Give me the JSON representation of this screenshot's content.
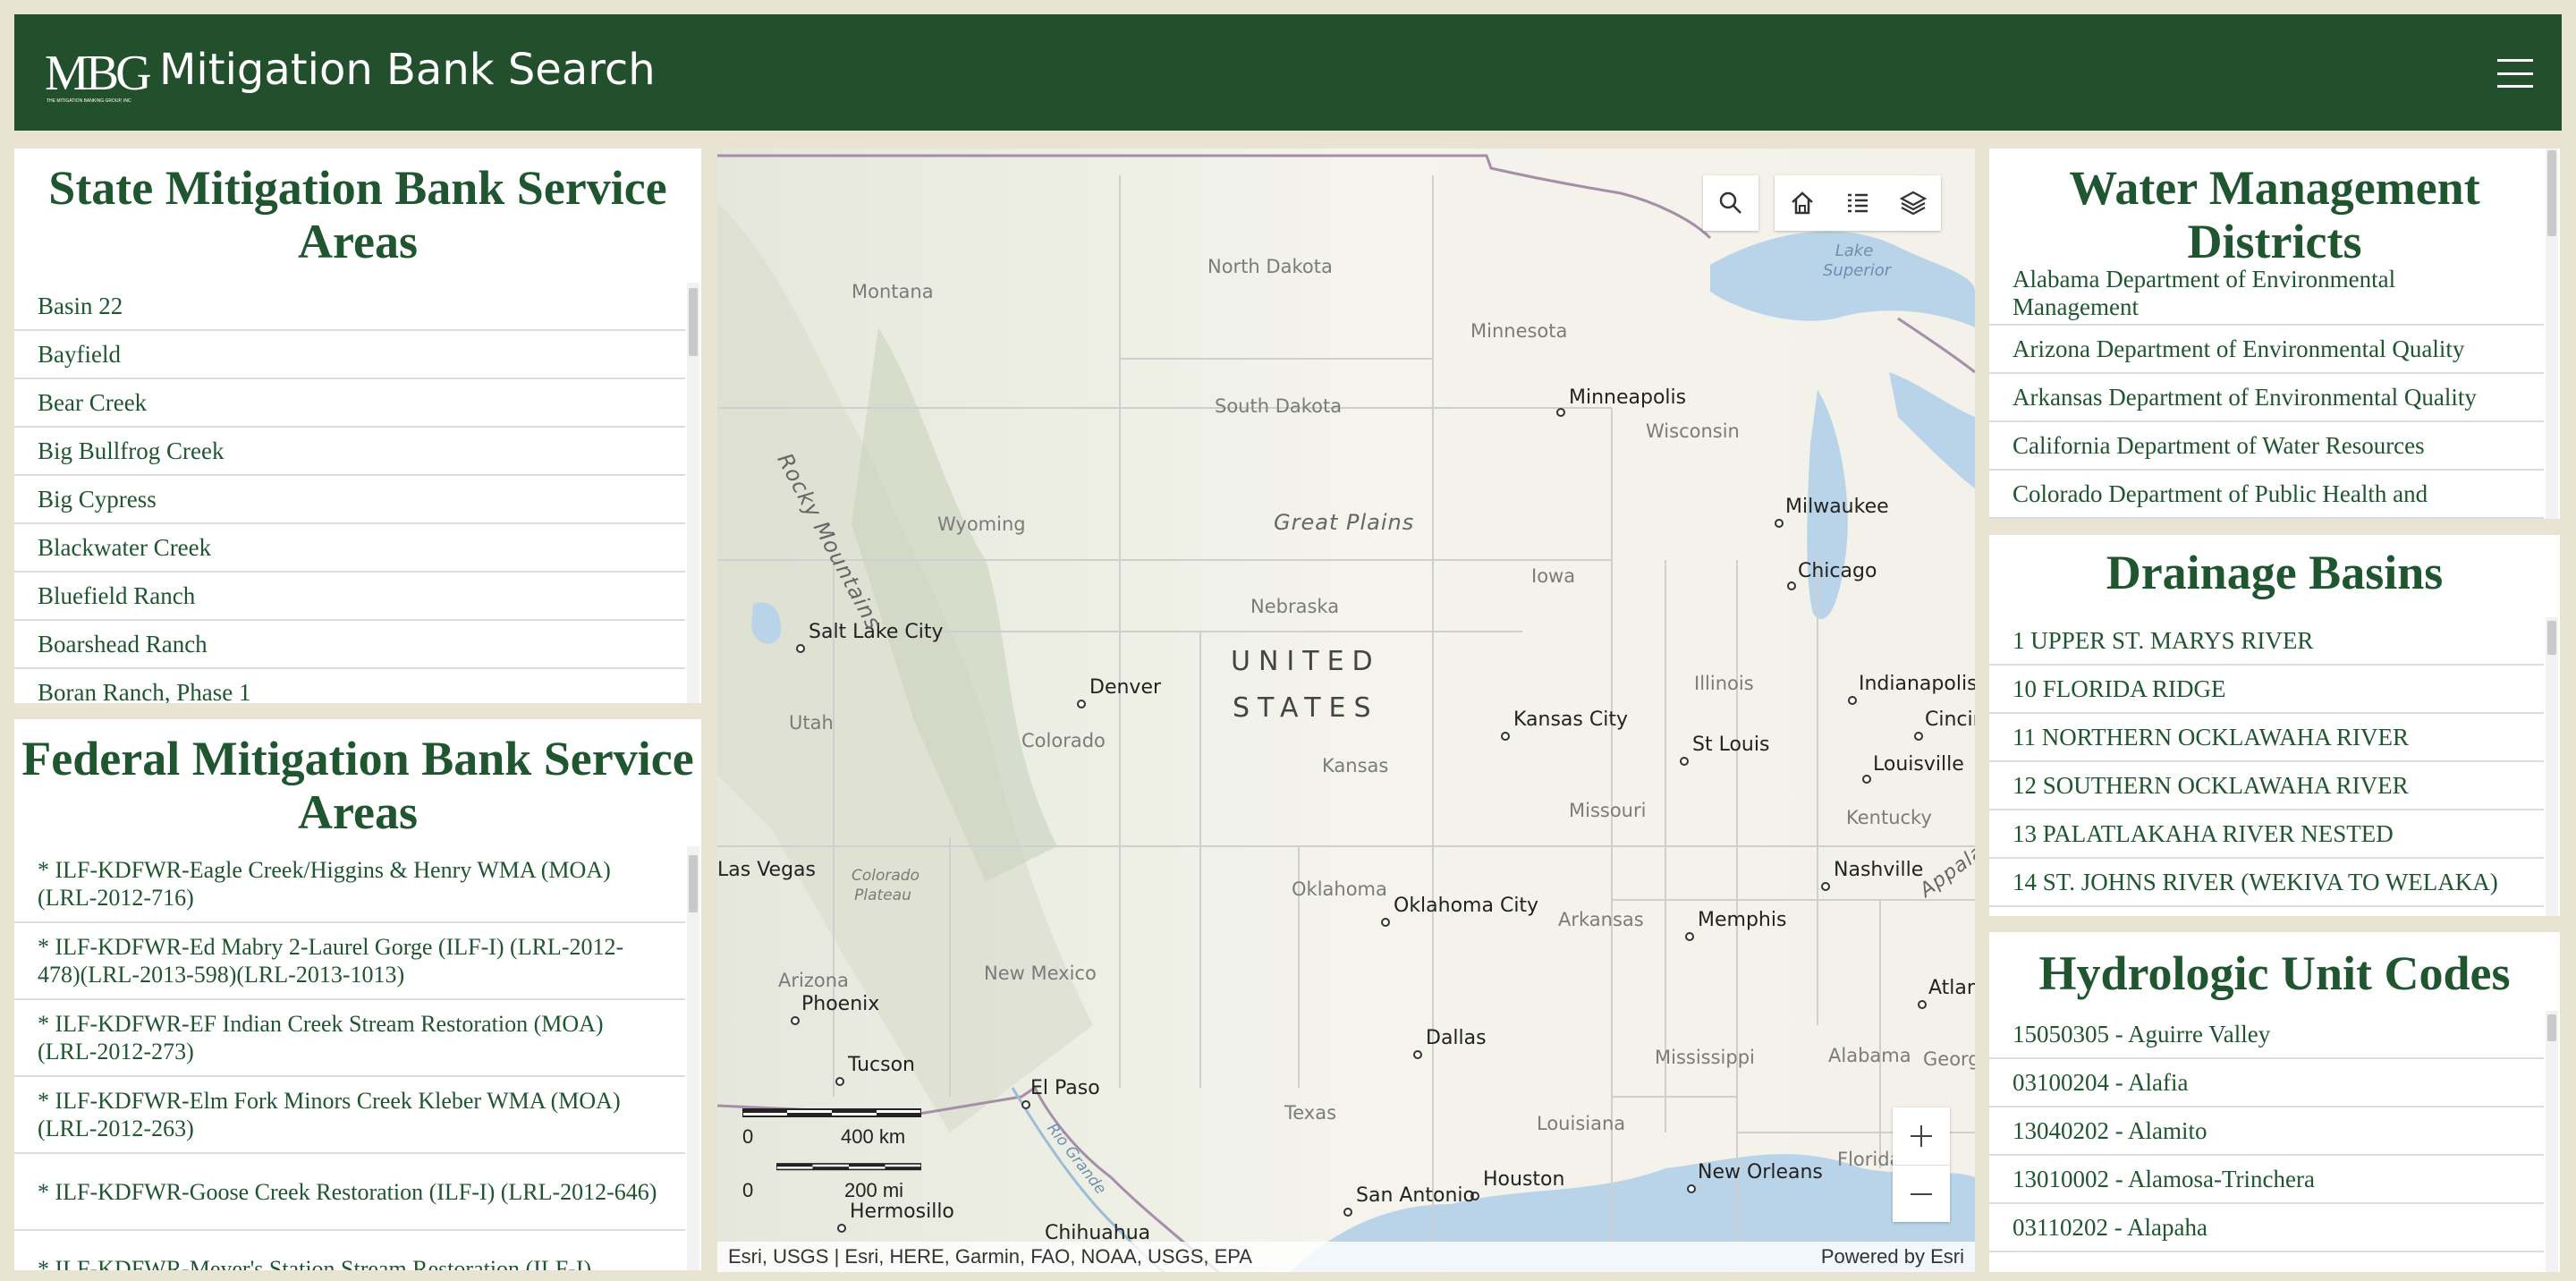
{
  "header": {
    "logo_text": "MBG",
    "logo_subtext": "THE MITIGATION BANKING GROUP, INC",
    "title": "Mitigation Bank Search",
    "menu_icon": "hamburger-menu-icon"
  },
  "state_panel": {
    "title": "State Mitigation Bank Service Areas",
    "items": [
      "Basin 22",
      "Bayfield",
      "Bear Creek",
      "Big Bullfrog Creek",
      "Big Cypress",
      "Blackwater Creek",
      "Bluefield Ranch",
      "Boarshead Ranch",
      "Boran Ranch, Phase 1"
    ]
  },
  "federal_panel": {
    "title": "Federal Mitigation Bank Service Areas",
    "items": [
      "* ILF-KDFWR-Eagle Creek/Higgins & Henry WMA (MOA) (LRL-2012-716)",
      "* ILF-KDFWR-Ed Mabry 2-Laurel Gorge (ILF-I) (LRL-2012-478)(LRL-2013-598)(LRL-2013-1013)",
      "* ILF-KDFWR-EF Indian Creek Stream Restoration (MOA) (LRL-2012-273)",
      "* ILF-KDFWR-Elm Fork Minors Creek Kleber WMA (MOA) (LRL-2012-263)",
      "* ILF-KDFWR-Goose Creek Restoration (ILF-I) (LRL-2012-646)",
      "* ILF-KDFWR-Meyer's Station Stream Restoration (ILF-I)"
    ]
  },
  "water_panel": {
    "title": "Water Management Districts",
    "items": [
      "Alabama Department of Environmental Management",
      "Arizona Department of Environmental Quality",
      "Arkansas Department of Environmental Quality",
      "California Department of Water Resources",
      "Colorado Department of Public Health and"
    ]
  },
  "drainage_panel": {
    "title": "Drainage Basins",
    "items": [
      "1 UPPER ST. MARYS RIVER",
      "10 FLORIDA RIDGE",
      "11 NORTHERN OCKLAWAHA RIVER",
      "12 SOUTHERN OCKLAWAHA RIVER",
      "13 PALATLAKAHA RIVER NESTED",
      "14 ST. JOHNS RIVER (WEKIVA TO WELAKA)"
    ]
  },
  "huc_panel": {
    "title": "Hydrologic Unit Codes",
    "items": [
      "15050305 - Aguirre Valley",
      "03100204 - Alafia",
      "13040202 - Alamito",
      "13010002 - Alamosa-Trinchera",
      "03110202 - Alapaha"
    ]
  },
  "map": {
    "states": [
      "North Dakota",
      "Montana",
      "Minnesota",
      "South Dakota",
      "Wisconsin",
      "Wyoming",
      "Iowa",
      "Nebraska",
      "Utah",
      "Colorado",
      "Illinois",
      "Kansas",
      "Missouri",
      "Kentucky",
      "Oklahoma",
      "Arkansas",
      "Arizona",
      "New Mexico",
      "Mississippi",
      "Alabama",
      "Texas",
      "Louisiana",
      "Florida",
      "Georgia"
    ],
    "cities": [
      "Minneapolis",
      "Milwaukee",
      "Chicago",
      "Salt Lake City",
      "Denver",
      "Kansas City",
      "St Louis",
      "Indianapolis",
      "Cincinnati",
      "Louisville",
      "Nashville",
      "Oklahoma City",
      "Memphis",
      "Phoenix",
      "Tucson",
      "El Paso",
      "Dallas",
      "Atlanta",
      "Houston",
      "San Antonio",
      "New Orleans",
      "Las Vegas",
      "Hermosillo",
      "Chihuahua"
    ],
    "country_label_1": "UNITED",
    "country_label_2": "STATES",
    "physical": [
      "Rocky Mountains",
      "Great Plains",
      "Colorado Plateau",
      "Appalachian Mountains"
    ],
    "water": [
      "Lake Superior",
      "Rio Grande"
    ],
    "scale_km_zero": "0",
    "scale_km": "400 km",
    "scale_mi_zero": "0",
    "scale_mi": "200 mi",
    "attribution": "Esri, USGS | Esri, HERE, Garmin, FAO, NOAA, USGS, EPA",
    "powered_by": "Powered by Esri",
    "tools": [
      "search-icon",
      "home-icon",
      "legend-list-icon",
      "layers-icon"
    ],
    "zoom_in": "+",
    "zoom_out": "—"
  }
}
